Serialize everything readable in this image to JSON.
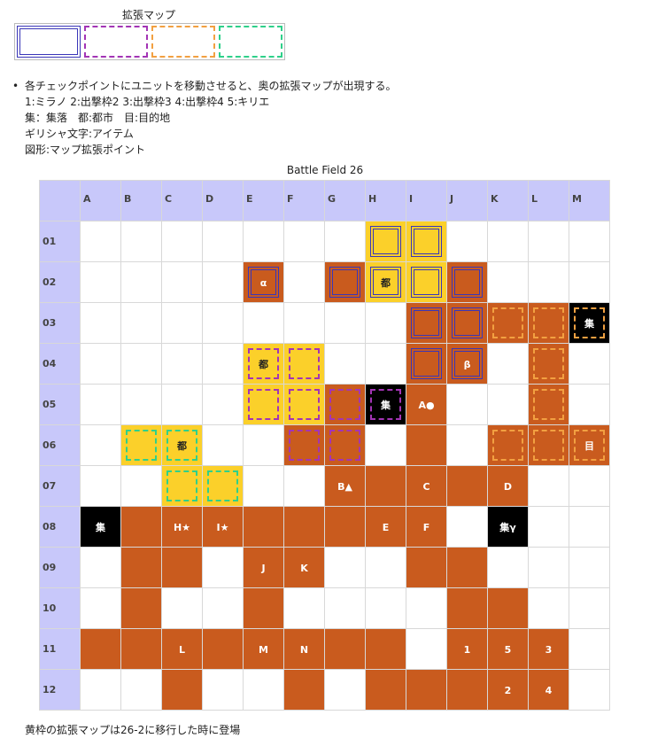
{
  "legend": {
    "title": "拡張マップ",
    "items": [
      {
        "style": "double-blue",
        "color": "#3a36b8"
      },
      {
        "style": "dashed-purple",
        "color": "#a334b5"
      },
      {
        "style": "dashed-orange",
        "color": "#f2a041"
      },
      {
        "style": "dashed-green",
        "color": "#2fd08a"
      }
    ]
  },
  "notes": [
    "各チェックポイントにユニットを移動させると、奥の拡張マップが出現する。",
    "1:ミラノ 2:出撃枠2 3:出撃枠3 4:出撃枠4 5:キリエ",
    "集：集落　都:都市　目:目的地",
    "ギリシャ文字:アイテム",
    "図形:マップ拡張ポイント"
  ],
  "grid": {
    "title": "Battle Field 26",
    "columns": [
      "A",
      "B",
      "C",
      "D",
      "E",
      "F",
      "G",
      "H",
      "I",
      "J",
      "K",
      "L",
      "M"
    ],
    "rows": [
      "01",
      "02",
      "03",
      "04",
      "05",
      "06",
      "07",
      "08",
      "09",
      "10",
      "11",
      "12"
    ],
    "colors": {
      "land": "#c95b1e",
      "yellow": "#fbd02a",
      "village": "#000000",
      "header": "#c8c8fa"
    },
    "cells": [
      [
        "",
        "",
        "",
        "",
        "",
        "",
        "",
        "y|b|",
        "y|b|",
        "",
        "",
        "",
        ""
      ],
      [
        "",
        "",
        "",
        "",
        "o|b|α",
        "",
        "o|b|",
        "y|b|都",
        "y|b|",
        "o|b|",
        "",
        "",
        ""
      ],
      [
        "",
        "",
        "",
        "",
        "",
        "",
        "",
        "",
        "o|b|",
        "o|b|",
        "o|a|",
        "o|a|",
        "k|a|集"
      ],
      [
        "",
        "",
        "",
        "",
        "y|p|都",
        "y|p|",
        "",
        "",
        "o|b|",
        "o|b|β",
        "",
        "o|a|",
        ""
      ],
      [
        "",
        "",
        "",
        "",
        "y|p|",
        "y|p|",
        "o|p|",
        "k|p|集",
        "o||A●",
        "",
        "",
        "o|a|",
        ""
      ],
      [
        "",
        "y|g|",
        "y|g|都",
        "",
        "",
        "o|p|",
        "o|p|",
        "",
        "o||",
        "",
        "o|a|",
        "o|a|",
        "o|a|目"
      ],
      [
        "",
        "",
        "y|g|",
        "y|g|",
        "",
        "",
        "o||B▲",
        "o||",
        "o||C",
        "o||",
        "o||D",
        "",
        ""
      ],
      [
        "k||集",
        "o||",
        "o||H★",
        "o||I★",
        "o||",
        "o||",
        "o||",
        "o||E",
        "o||F",
        "",
        "k||集γ",
        "",
        ""
      ],
      [
        "",
        "o||",
        "o||",
        "",
        "o||J",
        "o||K",
        "",
        "",
        "o||",
        "o||",
        "",
        "",
        ""
      ],
      [
        "",
        "o||",
        "",
        "",
        "o||",
        "",
        "",
        "",
        "",
        "o||",
        "o||",
        "",
        ""
      ],
      [
        "o||",
        "o||",
        "o||L",
        "o||",
        "o||M",
        "o||N",
        "o||",
        "o||",
        "",
        "o||1",
        "o||5",
        "o||3",
        ""
      ],
      [
        "",
        "",
        "o||",
        "",
        "",
        "o||",
        "",
        "o||",
        "o||",
        "o||",
        "o||2",
        "o||4",
        ""
      ]
    ]
  },
  "footnote": "黄枠の拡張マップは26-2に移行した時に登場"
}
